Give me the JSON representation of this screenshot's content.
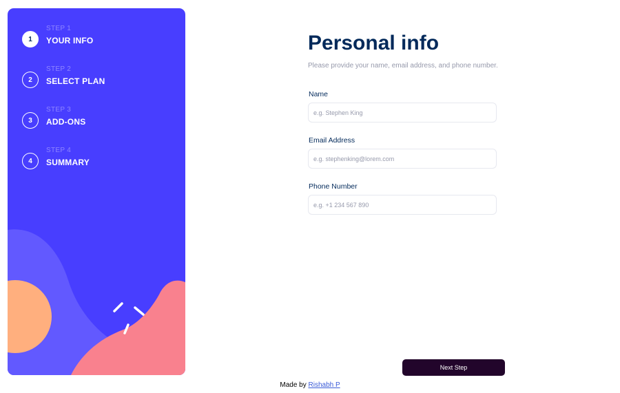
{
  "sidebar": {
    "steps": [
      {
        "number": "1",
        "kicker": "STEP 1",
        "title": "YOUR INFO",
        "active": true
      },
      {
        "number": "2",
        "kicker": "STEP 2",
        "title": "SELECT PLAN",
        "active": false
      },
      {
        "number": "3",
        "kicker": "STEP 3",
        "title": "ADD-ONS",
        "active": false
      },
      {
        "number": "4",
        "kicker": "STEP 4",
        "title": "SUMMARY",
        "active": false
      }
    ]
  },
  "main": {
    "title": "Personal info",
    "subtitle": "Please provide your name, email address, and phone number.",
    "fields": [
      {
        "label": "Name",
        "placeholder": "e.g. Stephen King",
        "value": ""
      },
      {
        "label": "Email Address",
        "placeholder": "e.g. stephenking@lorem.com",
        "value": ""
      },
      {
        "label": "Phone Number",
        "placeholder": "e.g. +1 234 567 890",
        "value": ""
      }
    ],
    "next_label": "Next Step"
  },
  "footer": {
    "prefix": "Made by",
    "author": "Rishabh P"
  },
  "colors": {
    "sidebar_bg": "#483eff",
    "wave_light": "#6259ff",
    "circle_orange": "#ffaf7e",
    "wave_pink": "#f9818e",
    "heading": "#02295a",
    "muted": "#9699ab",
    "button_bg": "#22052b",
    "link": "#3a5bd8"
  }
}
